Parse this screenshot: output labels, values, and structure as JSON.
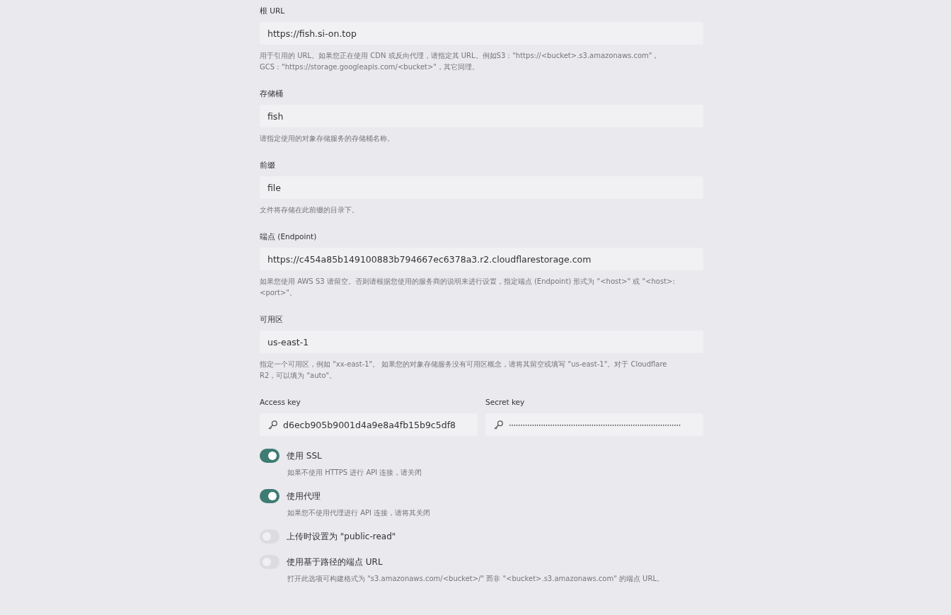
{
  "fields": [
    {
      "label": "根 URL",
      "value": "https://fish.si-on.top",
      "hint": "用于引用的 URL。如果您正在使用 CDN 或反向代理，请指定其 URL。例如S3：\"https://<bucket>.s3.amazonaws.com\"，GCS：\"https://storage.googleapis.com/<bucket>\"，其它同理。"
    },
    {
      "label": "存储桶",
      "value": "fish",
      "hint": "请指定使用的对象存储服务的存储桶名称。"
    },
    {
      "label": "前缀",
      "value": "file",
      "hint": "文件将存储在此前缀的目录下。"
    },
    {
      "label": "端点 (Endpoint)",
      "value": "https://c454a85b149100883b794667ec6378a3.r2.cloudflarestorage.com",
      "hint": "如果您使用 AWS S3 请留空。否则请根据您使用的服务商的说明来进行设置，指定端点 (Endpoint) 形式为 \"<host>\" 或 \"<host>:<port>\"。"
    },
    {
      "label": "可用区",
      "value": "us-east-1",
      "hint": "指定一个可用区，例如 \"xx-east-1\"。 如果您的对象存储服务没有可用区概念，请将其留空或填写 \"us-east-1\"。对于 Cloudflare R2，可以填为 \"auto\"。"
    }
  ],
  "keys": [
    {
      "label": "Access key",
      "value": "d6ecb905b9001d4a9e8a4fb15b9c5df8",
      "kind": "text"
    },
    {
      "label": "Secret key",
      "value": "•••••••••••••••••••••••••••••••••••••••••••••••••••••••••••••••••••••••••••",
      "kind": "masked"
    }
  ],
  "toggles": [
    {
      "label": "使用 SSL",
      "on": true,
      "hint": "如果不使用 HTTPS 进行 API 连接，请关闭"
    },
    {
      "label": "使用代理",
      "on": true,
      "hint": "如果您不使用代理进行 API 连接，请将其关闭"
    },
    {
      "label": "上传时设置为 \"public-read\"",
      "on": false
    },
    {
      "label": "使用基于路径的端点 URL",
      "on": false,
      "hint": "打开此选项可构建格式为 \"s3.amazonaws.com/<bucket>/\" 而非 \"<bucket>.s3.amazonaws.com\" 的端点 URL。"
    }
  ]
}
